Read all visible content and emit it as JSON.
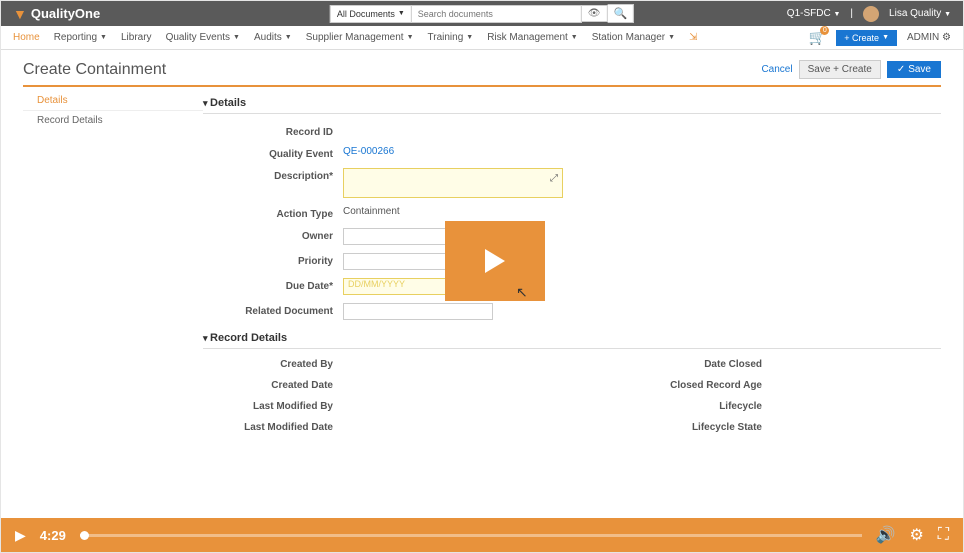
{
  "top": {
    "brand": "QualityOne",
    "searchScope": "All Documents",
    "searchPlaceholder": "Search documents",
    "env": "Q1-SFDC",
    "user": "Lisa Quality"
  },
  "nav": {
    "items": [
      "Home",
      "Reporting",
      "Library",
      "Quality Events",
      "Audits",
      "Supplier Management",
      "Training",
      "Risk Management",
      "Station Manager"
    ],
    "cartCount": "0",
    "create": "+ Create",
    "admin": "ADMIN"
  },
  "page": {
    "title": "Create Containment",
    "cancel": "Cancel",
    "saveCreate": "Save + Create",
    "save": "Save"
  },
  "side": {
    "details": "Details",
    "record": "Record Details"
  },
  "sections": {
    "details": "Details",
    "record": "Record Details"
  },
  "fields": {
    "recordId": "Record ID",
    "qualityEvent": "Quality Event",
    "qualityEventVal": "QE-000266",
    "description": "Description*",
    "actionType": "Action Type",
    "actionTypeVal": "Containment",
    "owner": "Owner",
    "priority": "Priority",
    "dueDate": "Due Date*",
    "dueDatePh": "DD/MM/YYYY",
    "relatedDoc": "Related Document"
  },
  "record": {
    "left": [
      "Created By",
      "Created Date",
      "Last Modified By",
      "Last Modified Date"
    ],
    "right": [
      "Date Closed",
      "Closed Record Age",
      "Lifecycle",
      "Lifecycle State"
    ]
  },
  "player": {
    "time": "4:29"
  }
}
